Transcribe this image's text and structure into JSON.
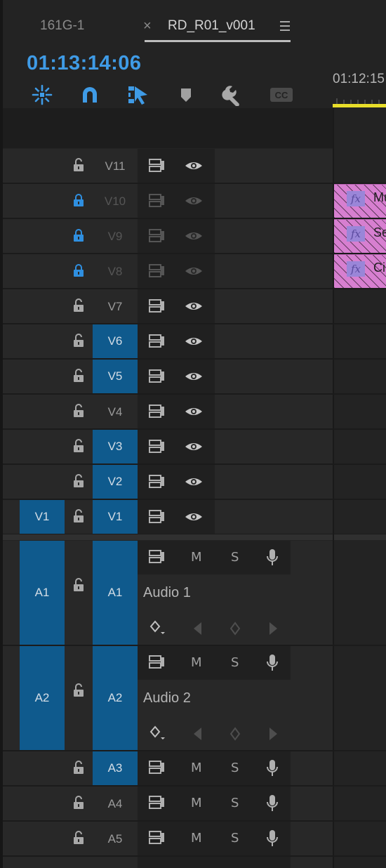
{
  "tabs": [
    {
      "label": "161G-1",
      "active": false
    },
    {
      "label": "RD_R01_v001",
      "active": true
    }
  ],
  "tab_close_glyph": "×",
  "tab_menu_icon": "hamburger-menu-icon",
  "timecode": "01:13:14:06",
  "ruler_label": "01:12:15",
  "toolbar_icons": [
    "nest-sequence-icon",
    "snap-magnet-icon",
    "linked-selection-icon",
    "add-marker-icon",
    "wrench-settings-icon",
    "closed-captions-icon"
  ],
  "cc_label": "CC",
  "video_tracks": [
    {
      "label": "V11",
      "locked": false,
      "target": false,
      "visible": true
    },
    {
      "label": "V10",
      "locked": true,
      "target": false,
      "visible": true
    },
    {
      "label": "V9",
      "locked": true,
      "target": false,
      "visible": true
    },
    {
      "label": "V8",
      "locked": true,
      "target": false,
      "visible": true
    },
    {
      "label": "V7",
      "locked": false,
      "target": false,
      "visible": true
    },
    {
      "label": "V6",
      "locked": false,
      "target": true,
      "visible": true
    },
    {
      "label": "V5",
      "locked": false,
      "target": true,
      "visible": true
    },
    {
      "label": "V4",
      "locked": false,
      "target": false,
      "visible": true
    },
    {
      "label": "V3",
      "locked": false,
      "target": true,
      "visible": true
    },
    {
      "label": "V2",
      "locked": false,
      "target": true,
      "visible": true
    },
    {
      "label": "V1",
      "locked": false,
      "target": true,
      "visible": true,
      "source": "V1"
    }
  ],
  "audio_tracks": [
    {
      "label": "A1",
      "source": "A1",
      "name": "Audio 1",
      "expanded": true
    },
    {
      "label": "A2",
      "source": "A2",
      "name": "Audio 2",
      "expanded": true
    },
    {
      "label": "A3",
      "target": true
    },
    {
      "label": "A4",
      "target": false
    },
    {
      "label": "A5",
      "target": false
    }
  ],
  "audio_buttons": {
    "mute": "M",
    "solo": "S"
  },
  "clips": [
    {
      "track": "V10",
      "fx": "fx",
      "name": "Mu"
    },
    {
      "track": "V9",
      "fx": "fx",
      "name": "Se"
    },
    {
      "track": "V8",
      "fx": "fx",
      "name": "Ci"
    }
  ],
  "colors": {
    "accent_blue": "#3f9be6",
    "target_blue": "#0f5a8d",
    "lock_blue": "#2f8fe0",
    "playhead_yellow": "#e8de2a",
    "clip_pink": "#d77fd0"
  }
}
